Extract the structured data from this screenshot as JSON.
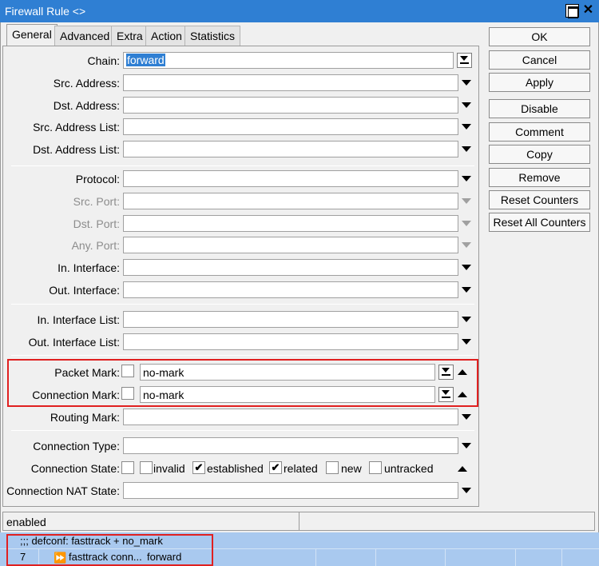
{
  "window": {
    "title": "Firewall Rule <>",
    "maximize_icon": "maximize-icon",
    "close_glyph": "✕"
  },
  "tabs": [
    "General",
    "Advanced",
    "Extra",
    "Action",
    "Statistics"
  ],
  "fields": {
    "chain": {
      "label": "Chain:",
      "value": "forward"
    },
    "src_address": {
      "label": "Src. Address:"
    },
    "dst_address": {
      "label": "Dst. Address:"
    },
    "src_address_list": {
      "label": "Src. Address List:"
    },
    "dst_address_list": {
      "label": "Dst. Address List:"
    },
    "protocol": {
      "label": "Protocol:"
    },
    "src_port": {
      "label": "Src. Port:"
    },
    "dst_port": {
      "label": "Dst. Port:"
    },
    "any_port": {
      "label": "Any. Port:"
    },
    "in_interface": {
      "label": "In. Interface:"
    },
    "out_interface": {
      "label": "Out. Interface:"
    },
    "in_interface_list": {
      "label": "In. Interface List:"
    },
    "out_interface_list": {
      "label": "Out. Interface List:"
    },
    "packet_mark": {
      "label": "Packet Mark:",
      "value": "no-mark"
    },
    "connection_mark": {
      "label": "Connection Mark:",
      "value": "no-mark"
    },
    "routing_mark": {
      "label": "Routing Mark:"
    },
    "connection_type": {
      "label": "Connection Type:"
    },
    "connection_state": {
      "label": "Connection State:"
    },
    "connection_nat_state": {
      "label": "Connection NAT State:"
    }
  },
  "connection_states": [
    {
      "label": "invalid",
      "checked": false
    },
    {
      "label": "established",
      "checked": true
    },
    {
      "label": "related",
      "checked": true
    },
    {
      "label": "new",
      "checked": false
    },
    {
      "label": "untracked",
      "checked": false
    }
  ],
  "check_glyph": "✔",
  "buttons": [
    "OK",
    "Cancel",
    "Apply",
    "Disable",
    "Comment",
    "Copy",
    "Remove",
    "Reset Counters",
    "Reset All Counters"
  ],
  "status": {
    "state": "enabled"
  },
  "list": {
    "comment": ";;; defconf: fasttrack + no_mark",
    "row": {
      "number": "7",
      "action_icon": "fasttrack-icon",
      "action_glyph": "⏩",
      "action": "fasttrack conn...",
      "chain": "forward"
    }
  },
  "colors": {
    "titlebar": "#2f7fd3",
    "highlight": "#e02020",
    "list_bg": "#a9c9ef",
    "selection": "#2f7fd3"
  }
}
